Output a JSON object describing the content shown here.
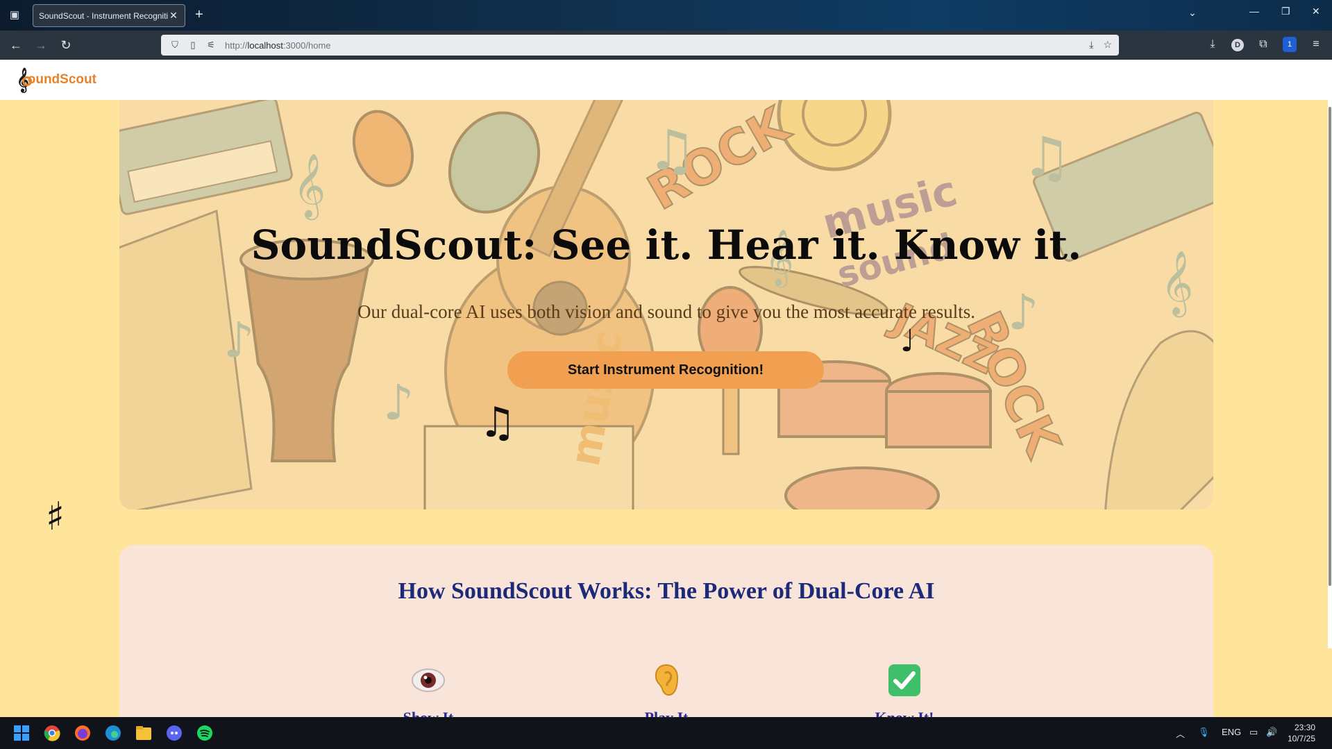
{
  "browser": {
    "tab_title": "SoundScout - Instrument Recognition",
    "tab_close": "✕",
    "new_tab": "+",
    "url_host": "localhost",
    "url_prefix": "http://",
    "url_suffix": ":3000/home"
  },
  "header": {
    "logo_clef": "𝄞",
    "logo_text_a": "ound",
    "logo_text_b": "Scout"
  },
  "hero": {
    "title": "SoundScout: See it. Hear it. Know it.",
    "subtitle": "Our dual-core AI uses both vision and sound to give you the most accurate results.",
    "cta_label": "Start Instrument Recognition!"
  },
  "floating_notes": {
    "quarter": "♩",
    "beamed": "♫",
    "sharp": "♯"
  },
  "how_it_works": {
    "title": "How SoundScout Works: The Power of Dual-Core AI",
    "steps": [
      {
        "icon": "eye-icon",
        "glyph": "👁",
        "label": "Show It"
      },
      {
        "icon": "ear-icon",
        "glyph": "👂",
        "label": "Play It"
      },
      {
        "icon": "check-icon",
        "glyph": "✔",
        "label": "Know It!"
      }
    ]
  },
  "taskbar": {
    "language": "ENG",
    "time": "23:30",
    "date": "10/7/25",
    "profile_initial": "D",
    "ext_badge": "1"
  },
  "colors": {
    "page_bg": "#ffe59c",
    "cta": "#f0a050",
    "heading_blue": "#1d2a7a",
    "logo_orange": "#e6832a",
    "logo_blue": "#1f4d8f"
  }
}
